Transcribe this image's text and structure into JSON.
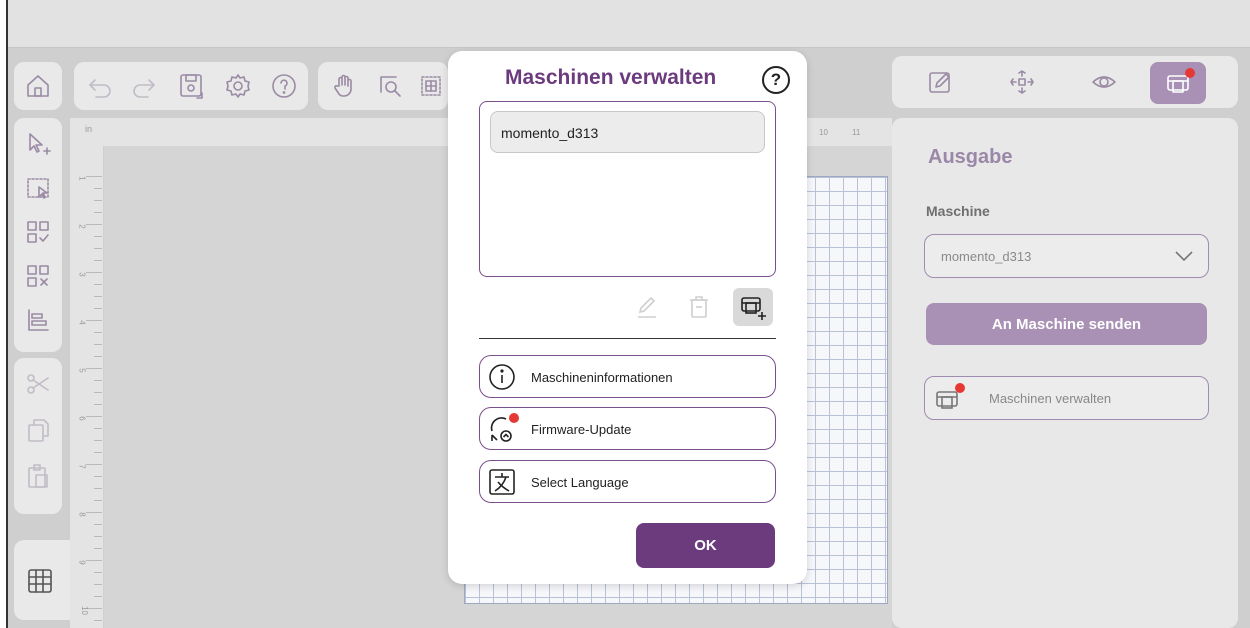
{
  "toolbar": {
    "icons": [
      "home-icon",
      "undo-icon",
      "redo-icon",
      "save-icon",
      "settings-icon",
      "help-icon",
      "hand-icon",
      "zoom-fit-icon",
      "grid-select-icon"
    ]
  },
  "right_toolbar": {
    "icons": [
      "edit-icon",
      "arrange-icon",
      "preview-icon",
      "machine-icon"
    ]
  },
  "ruler": {
    "unit": "in",
    "left_numbers": [
      "1",
      "2",
      "3",
      "4",
      "5",
      "6",
      "7",
      "8",
      "9",
      "10"
    ],
    "top_numbers": [
      "10",
      "11"
    ]
  },
  "modal": {
    "title": "Maschinen verwalten",
    "help": "?",
    "machines": [
      "momento_d313"
    ],
    "options": [
      {
        "label": "Maschineninformationen",
        "icon": "info-icon"
      },
      {
        "label": "Firmware-Update",
        "icon": "firmware-update-icon"
      },
      {
        "label": "Select Language",
        "icon": "language-icon"
      }
    ],
    "ok_label": "OK"
  },
  "panel": {
    "title": "Ausgabe",
    "machine_label": "Maschine",
    "machine_value": "momento_d313",
    "send_label": "An Maschine senden",
    "manage_label": "Maschinen verwalten"
  },
  "colors": {
    "accent": "#6c3b7d",
    "accent_light": "#a891b4",
    "notification": "#e53935"
  }
}
